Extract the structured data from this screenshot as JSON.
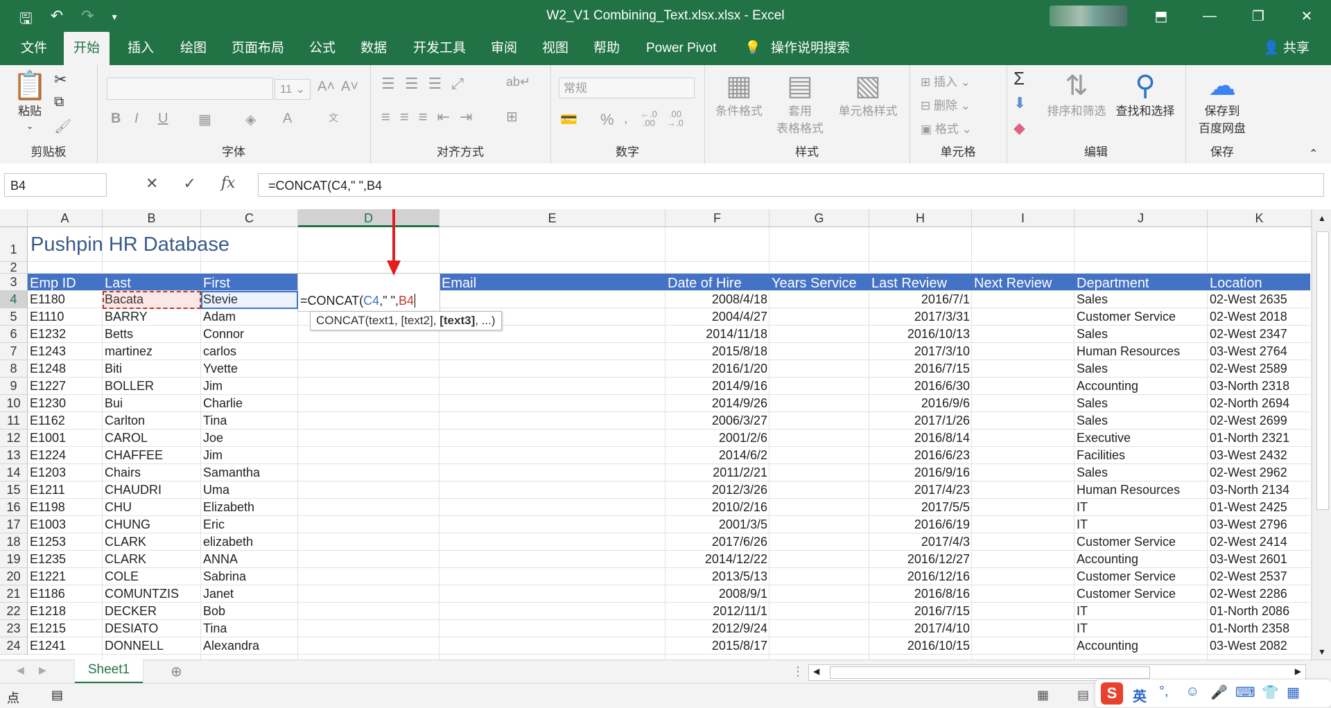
{
  "window": {
    "title": "W2_V1 Combining_Text.xlsx.xlsx  -  Excel",
    "minimize": "—",
    "restore": "❐",
    "close": "✕",
    "ribbon_display": "⬒"
  },
  "tabs": [
    "文件",
    "开始",
    "插入",
    "绘图",
    "页面布局",
    "公式",
    "数据",
    "开发工具",
    "审阅",
    "视图",
    "帮助",
    "Power Pivot"
  ],
  "tell_me": "操作说明搜索",
  "share": "共享",
  "ribbon": {
    "clipboard": {
      "label": "剪贴板",
      "paste": "粘贴"
    },
    "font": {
      "label": "字体",
      "size": "11",
      "bold": "B",
      "italic": "I",
      "underline": "U"
    },
    "alignment": {
      "label": "对齐方式"
    },
    "number": {
      "label": "数字",
      "format": "常规",
      "percent": "%"
    },
    "styles": {
      "label": "样式",
      "conditional": "条件格式",
      "table_format_1": "套用",
      "table_format_2": "表格格式",
      "cell_styles": "单元格样式"
    },
    "cells": {
      "label": "单元格",
      "insert": "插入",
      "delete": "删除",
      "format": "格式"
    },
    "editing": {
      "label": "编辑",
      "sort_filter": "排序和筛选",
      "find_select": "查找和选择"
    },
    "save": {
      "label": "保存",
      "save_to_1": "保存到",
      "save_to_2": "百度网盘"
    }
  },
  "formula_bar": {
    "name_box": "B4",
    "formula": "=CONCAT(C4,\" \",B4"
  },
  "columns": [
    "A",
    "B",
    "C",
    "D",
    "E",
    "F",
    "G",
    "H",
    "I",
    "J",
    "K"
  ],
  "sheet_title": "Pushpin HR Database",
  "headers": [
    "Emp ID",
    "Last",
    "First",
    "",
    "Email",
    "Date of Hire",
    "Years Service",
    "Last Review",
    "Next Review",
    "Department",
    "Location"
  ],
  "editing_cell": {
    "prefix": "=CONCAT(",
    "ref1": "C4",
    "middle": ",\" \",",
    "ref2": "B4"
  },
  "tooltip": {
    "fn": "CONCAT(text1, [text2], ",
    "bold": "[text3]",
    "rest": ", ...)"
  },
  "rows": [
    {
      "n": "4",
      "id": "E1180",
      "last": "Bacata",
      "first": "Stevie",
      "hire": "2008/4/18",
      "review": "2016/7/1",
      "dept": "Sales",
      "loc": "02-West 2635"
    },
    {
      "n": "5",
      "id": "E1110",
      "last": "BARRY",
      "first": "Adam",
      "hire": "2004/4/27",
      "review": "2017/3/31",
      "dept": "Customer Service",
      "loc": "02-West 2018"
    },
    {
      "n": "6",
      "id": "E1232",
      "last": "Betts",
      "first": "Connor",
      "hire": "2014/11/18",
      "review": "2016/10/13",
      "dept": "Sales",
      "loc": "02-West 2347"
    },
    {
      "n": "7",
      "id": "E1243",
      "last": "martinez",
      "first": "carlos",
      "hire": "2015/8/18",
      "review": "2017/3/10",
      "dept": "Human Resources",
      "loc": "03-West 2764"
    },
    {
      "n": "8",
      "id": "E1248",
      "last": "Biti",
      "first": "Yvette",
      "hire": "2016/1/20",
      "review": "2016/7/15",
      "dept": "Sales",
      "loc": "02-West 2589"
    },
    {
      "n": "9",
      "id": "E1227",
      "last": "BOLLER",
      "first": "Jim",
      "hire": "2014/9/16",
      "review": "2016/6/30",
      "dept": "Accounting",
      "loc": "03-North 2318"
    },
    {
      "n": "10",
      "id": "E1230",
      "last": "Bui",
      "first": "Charlie",
      "hire": "2014/9/26",
      "review": "2016/9/6",
      "dept": "Sales",
      "loc": "02-North 2694"
    },
    {
      "n": "11",
      "id": "E1162",
      "last": "Carlton",
      "first": "Tina",
      "hire": "2006/3/27",
      "review": "2017/1/26",
      "dept": "Sales",
      "loc": "02-West 2699"
    },
    {
      "n": "12",
      "id": "E1001",
      "last": "CAROL",
      "first": "Joe",
      "hire": "2001/2/6",
      "review": "2016/8/14",
      "dept": "Executive",
      "loc": "01-North 2321"
    },
    {
      "n": "13",
      "id": "E1224",
      "last": "CHAFFEE",
      "first": "Jim",
      "hire": "2014/6/2",
      "review": "2016/6/23",
      "dept": "Facilities",
      "loc": "03-West 2432"
    },
    {
      "n": "14",
      "id": "E1203",
      "last": "Chairs",
      "first": "Samantha",
      "hire": "2011/2/21",
      "review": "2016/9/16",
      "dept": "Sales",
      "loc": "02-West 2962"
    },
    {
      "n": "15",
      "id": "E1211",
      "last": "CHAUDRI",
      "first": "Uma",
      "hire": "2012/3/26",
      "review": "2017/4/23",
      "dept": "Human Resources",
      "loc": "03-North 2134"
    },
    {
      "n": "16",
      "id": "E1198",
      "last": "CHU",
      "first": "Elizabeth",
      "hire": "2010/2/16",
      "review": "2017/5/5",
      "dept": "IT",
      "loc": "01-West 2425"
    },
    {
      "n": "17",
      "id": "E1003",
      "last": "CHUNG",
      "first": "Eric",
      "hire": "2001/3/5",
      "review": "2016/6/19",
      "dept": "IT",
      "loc": "03-West 2796"
    },
    {
      "n": "18",
      "id": "E1253",
      "last": "CLARK",
      "first": "elizabeth",
      "hire": "2017/6/26",
      "review": "2017/4/3",
      "dept": "Customer Service",
      "loc": "02-West 2414"
    },
    {
      "n": "19",
      "id": "E1235",
      "last": "CLARK",
      "first": "ANNA",
      "hire": "2014/12/22",
      "review": "2016/12/27",
      "dept": "Accounting",
      "loc": "03-West 2601"
    },
    {
      "n": "20",
      "id": "E1221",
      "last": "COLE",
      "first": "Sabrina",
      "hire": "2013/5/13",
      "review": "2016/12/16",
      "dept": "Customer Service",
      "loc": "02-West 2537"
    },
    {
      "n": "21",
      "id": "E1186",
      "last": "COMUNTZIS",
      "first": "Janet",
      "hire": "2008/9/1",
      "review": "2016/8/16",
      "dept": "Customer Service",
      "loc": "02-West 2286"
    },
    {
      "n": "22",
      "id": "E1218",
      "last": "DECKER",
      "first": "Bob",
      "hire": "2012/11/1",
      "review": "2016/7/15",
      "dept": "IT",
      "loc": "01-North 2086"
    },
    {
      "n": "23",
      "id": "E1215",
      "last": "DESIATO",
      "first": "Tina",
      "hire": "2012/9/24",
      "review": "2017/4/10",
      "dept": "IT",
      "loc": "01-North 2358"
    },
    {
      "n": "24",
      "id": "E1241",
      "last": "DONNELL",
      "first": "Alexandra",
      "hire": "2015/8/17",
      "review": "2016/10/15",
      "dept": "Accounting",
      "loc": "03-West 2082"
    }
  ],
  "sheet_tab": "Sheet1",
  "status": {
    "mode": "点",
    "ime": "英"
  },
  "colors": {
    "excel_green": "#217346",
    "header_fill": "#4472c4",
    "ref_blue": "#3a73c7",
    "ref_red": "#c0392b",
    "arrow": "#e02020"
  }
}
